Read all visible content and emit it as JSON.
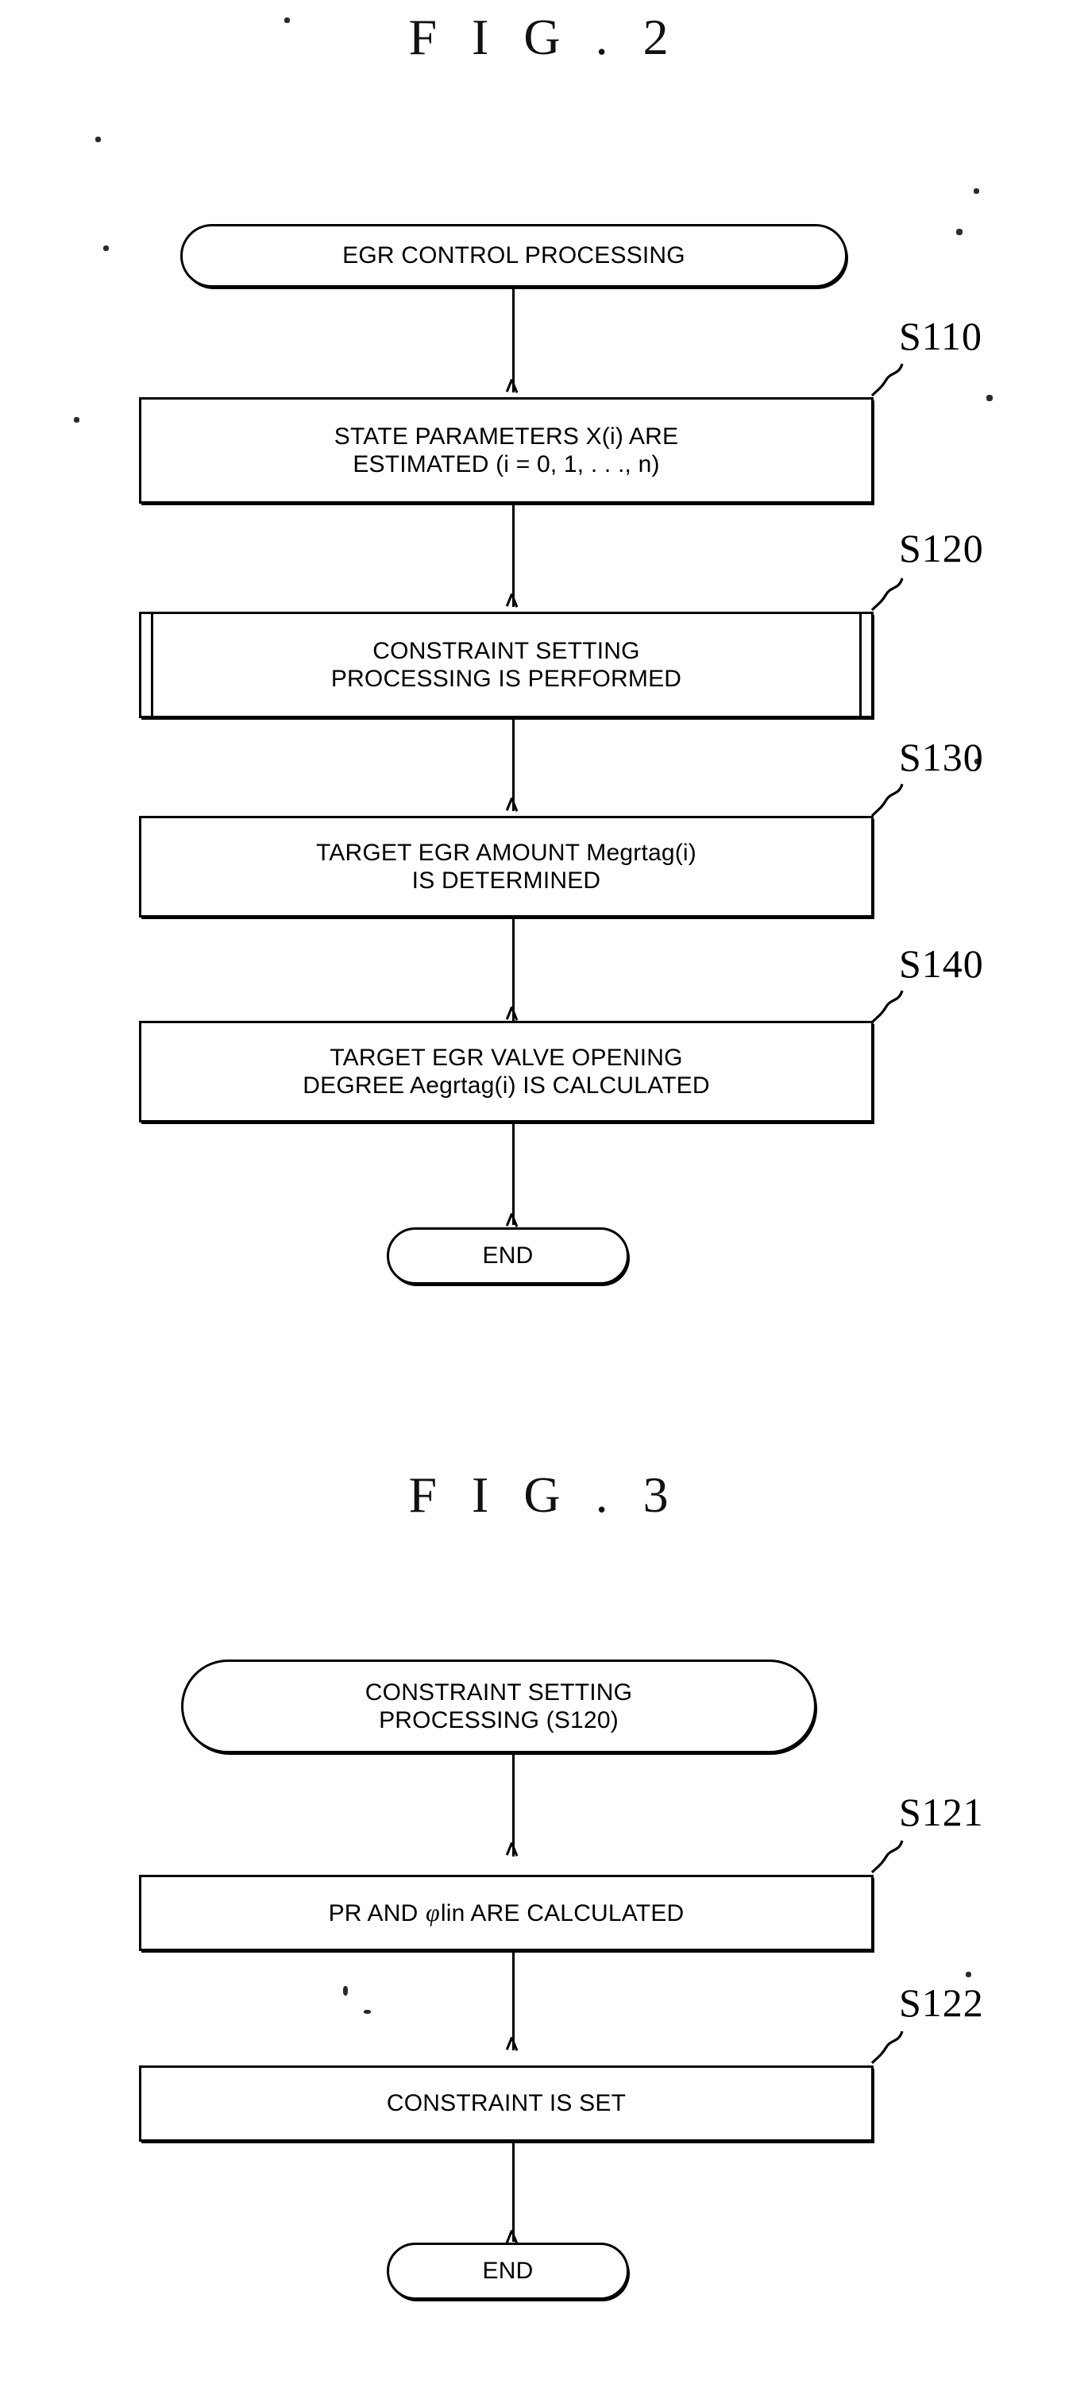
{
  "figures": [
    {
      "id": "fig2",
      "title": "F I G . 2",
      "nodes": {
        "start": {
          "text": "EGR CONTROL PROCESSING"
        },
        "s110": {
          "text": "STATE PARAMETERS X(i) ARE\nESTIMATED (i = 0, 1, . . ., n)",
          "ref": "S110"
        },
        "s120": {
          "text": "CONSTRAINT SETTING\nPROCESSING IS PERFORMED",
          "ref": "S120"
        },
        "s130": {
          "text": "TARGET EGR AMOUNT Megrtag(i)\nIS DETERMINED",
          "ref": "S130"
        },
        "s140": {
          "text": "TARGET EGR VALVE OPENING\nDEGREE Aegrtag(i) IS CALCULATED",
          "ref": "S140"
        },
        "end": {
          "text": "END"
        }
      }
    },
    {
      "id": "fig3",
      "title": "F I G . 3",
      "nodes": {
        "start": {
          "text": "CONSTRAINT SETTING\nPROCESSING (S120)"
        },
        "s121": {
          "text_before": "PR AND ",
          "phi": "φ",
          "text_after": "lin ARE CALCULATED",
          "ref": "S121"
        },
        "s122": {
          "text": "CONSTRAINT IS SET",
          "ref": "S122"
        },
        "end": {
          "text": "END"
        }
      }
    }
  ],
  "colors": {
    "ink": "#000000",
    "paper": "#ffffff"
  }
}
